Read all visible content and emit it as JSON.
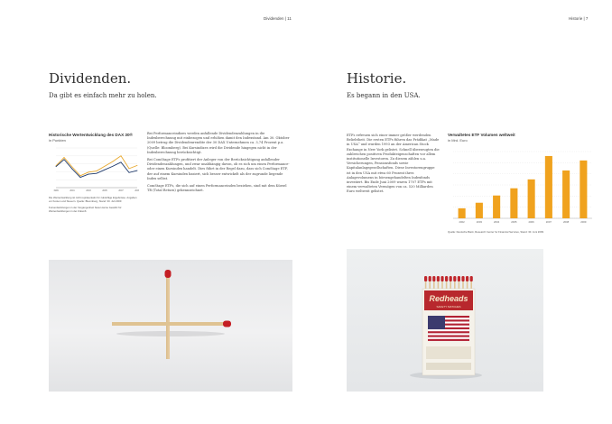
{
  "left_page": {
    "header": "Dividenden | 11",
    "title": "Dividenden.",
    "subtitle": "Da gibt es einfach mehr zu holen.",
    "chart": {
      "title": "Historische Wertentwicklung des DAX 30®",
      "subtitle": "in Punkten",
      "caption": "Die Wertentwicklung ist nicht repräsentativ für zukünftige Ergebnisse. Angaben vor Kosten und Steuern. Quelle: Bloomberg, Stand: 30. Juli 2009",
      "footnote": "Kursentwicklungen in der Vergangenheit bieten keine Gewähr für Wertentwicklungen in der Zukunft."
    },
    "body": [
      "Bei Performanceindizes werden anfallende Dividendenzahlungen in die Indexberechnung mit einbezogen und erhöhen damit den Indexstand. Am 30. Oktober 2009 betrug die Dividendenrendite der 30 DAX Unternehmen ca. 3,74 Prozent p.a. (Quelle: Bloomberg). Bei Kursindizes wird die Dividende hingegen nicht in der Indexberechnung berücksichtigt.",
      "Bei ComStage ETFs profitiert der Anleger von der Berücksichtigung anfallender Dividendenzahlungen, und zwar unabhängig davon, ob es sich um einen Performance- oder einen Kursindex handelt. Dies führt in der Regel dazu, dass sich ComStage ETF, der auf einem Kursindex basiert, sich besser entwickelt als der zugrunde liegende Index selbst.",
      "ComStage ETFs, die sich auf einen Performanceindex beziehen, sind mit dem Kürzel TR (Total Return) gekennzeichnet."
    ]
  },
  "right_page": {
    "header": "Historie | 7",
    "title": "Historie.",
    "subtitle": "Es begann in den USA.",
    "body": [
      "ETFs erfreuen sich einer immer größer werdenden Beliebtheit. Die ersten ETFs führen das Prädikat „Made in USA“ und wurden 1993 an der American Stock Exchange in New York gelistet. Schnell überzeugten die zahlreichen positiven Produkteigenschaften vor allem institutionelle Investoren. Zu diesem zählen u.a. Versicherungen, Pensionsfonds sowie Kapitalanlagegesellschaften. Diese Investorengruppe ist in den USA mit etwa 60 Prozent ihres Anlagevolumens in börsengehandelten Indexfonds investiert. Bis Ende Juni 2009 waren 1707 ETFs mit einem verwalteten Vermögen von ca. 520 Milliarden Euro weltweit gelistet."
    ],
    "chart": {
      "title": "Verwaltetes ETF Volumen weltweit",
      "subtitle": "in Mrd. Euro",
      "source": "Quelle: Deutsche Bank, Research Center for Financial Services, Stand: 30. Juni 2009"
    },
    "matchbox": {
      "brand": "Redheads",
      "tagline": "SAFETY MATCHES"
    }
  },
  "chart_data": [
    {
      "type": "line",
      "title": "Historische Wertentwicklung des DAX 30®",
      "ylabel": "in Punkten",
      "x": [
        "1999",
        "2000",
        "2001",
        "2002",
        "2003",
        "2004",
        "2005",
        "2006",
        "2007",
        "2008",
        "2009"
      ],
      "series": [
        {
          "values": [
            5500,
            7600,
            5200,
            3000,
            3900,
            4200,
            5400,
            6600,
            8000,
            4800,
            5600
          ]
        },
        {
          "values": [
            5300,
            7100,
            4700,
            2600,
            3400,
            3600,
            4500,
            5400,
            6400,
            3800,
            4300
          ]
        }
      ],
      "colors": [
        "#e8a82e",
        "#1f3a6b"
      ],
      "ylim": [
        0,
        10000
      ]
    },
    {
      "type": "bar",
      "title": "Verwaltetes ETF Volumen weltweit",
      "ylabel": "in Mrd. Euro",
      "categories": [
        "2002",
        "2003",
        "2004",
        "2005",
        "2006",
        "2007",
        "2008",
        "2009"
      ],
      "values": [
        90,
        140,
        205,
        270,
        350,
        560,
        430,
        520
      ],
      "color": "#f0a21e",
      "ylim": [
        0,
        600
      ]
    }
  ]
}
